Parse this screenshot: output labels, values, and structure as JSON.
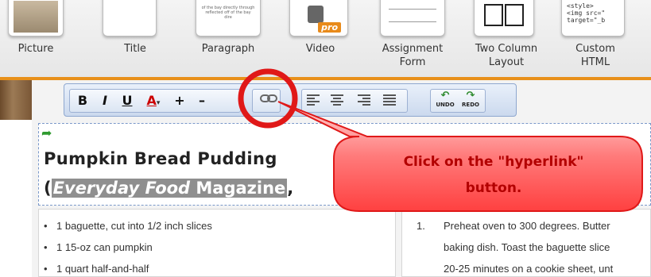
{
  "palette": {
    "items": [
      {
        "label": "Picture"
      },
      {
        "label": "Title"
      },
      {
        "label": "Paragraph"
      },
      {
        "label": "Video"
      },
      {
        "label": "Assignment\nForm"
      },
      {
        "label": "Two Column\nLayout"
      },
      {
        "label": "Custom\nHTML"
      }
    ],
    "paragraph_thumb_text": "of the bay directly through reflected off of the bay dire",
    "video_badge": "pro",
    "custom_html_code": "<style>\n<img src=\"\ntarget=\"_b"
  },
  "toolbar": {
    "bold": "B",
    "italic": "I",
    "underline": "U",
    "font_color": "A",
    "font_color_caret": "▾",
    "increase": "+",
    "decrease": "–",
    "undo_label": "UNDO",
    "redo_label": "REDO"
  },
  "title": {
    "line1": "Pumpkin Bread Pudding",
    "open_paren": "(",
    "italic_part": "Everyday Food",
    "highlight_rest": " Magazine",
    "trailing": ","
  },
  "ingredients": [
    "1 baguette, cut into 1/2 inch slices",
    "1 15-oz can pumpkin",
    "1 quart half-and-half"
  ],
  "steps": {
    "number": "1.",
    "lines": [
      "Preheat oven to 300 degrees. Butter",
      "baking dish. Toast the baguette slice",
      "20-25 minutes on a cookie sheet, unt"
    ]
  },
  "callout": {
    "line1": "Click on the \"hyperlink\"",
    "line2": "button."
  },
  "colors": {
    "callout_text": "#b30000",
    "callout_fill": "#ff4a4a",
    "circle": "#e01818",
    "accent_bar": "#e8901a"
  },
  "icons": {
    "hyperlink": "chain-link-icon",
    "undo": "undo-arrow-icon",
    "redo": "redo-arrow-icon",
    "title_arrow": "green-arrow-icon"
  }
}
